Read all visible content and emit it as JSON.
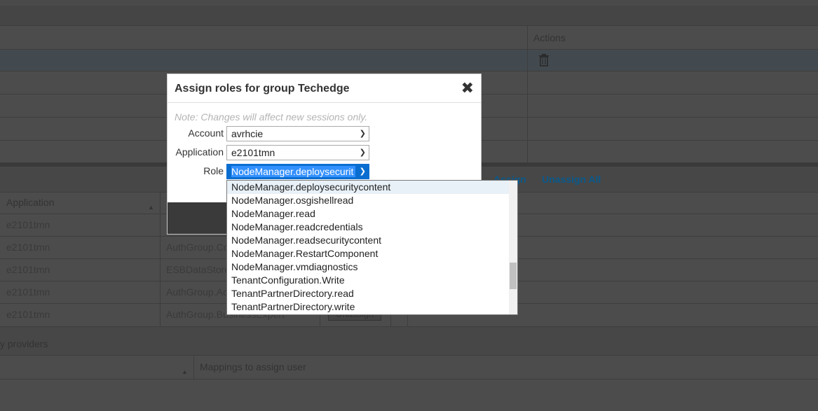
{
  "background": {
    "top_table": {
      "actions_header": "Actions",
      "trash_icon": "trash-icon"
    },
    "middle": {
      "assign_link": "Assign",
      "unassign_all_link": "Unassign All",
      "application_header": "Application",
      "rows": [
        {
          "application": "e2101tmn",
          "group": "",
          "button": ""
        },
        {
          "application": "e2101tmn",
          "group": "AuthGroup.Co",
          "button": ""
        },
        {
          "application": "e2101tmn",
          "group": "ESBDataStore",
          "button": ""
        },
        {
          "application": "e2101tmn",
          "group": "AuthGroup.Ac",
          "button": ""
        },
        {
          "application": "e2101tmn",
          "group": "AuthGroup.BusinessExpert",
          "button": "Unassign"
        }
      ]
    },
    "bottom": {
      "providers_label": "y providers",
      "mappings_header": "Mappings to assign user"
    }
  },
  "modal": {
    "title": "Assign roles for group Techedge",
    "close_icon": "close-icon",
    "note": "Note: Changes will affect new sessions only.",
    "account_label": "Account",
    "account_value": "avrhcie",
    "application_label": "Application",
    "application_value": "e2101tmn",
    "role_label": "Role",
    "role_value": "NodeManager.deploysecurit"
  },
  "role_options": [
    "NodeManager.deploysecuritycontent",
    "NodeManager.osgishellread",
    "NodeManager.read",
    "NodeManager.readcredentials",
    "NodeManager.readsecuritycontent",
    "NodeManager.RestartComponent",
    "NodeManager.vmdiagnostics",
    "TenantConfiguration.Write",
    "TenantPartnerDirectory.read",
    "TenantPartnerDirectory.write"
  ],
  "highlighted_option_index": 0,
  "colors": {
    "overlay": "#4c4c4c",
    "link": "#0a5a8c",
    "select_active": "#0a6ed1",
    "text_selection": "#3390ff"
  }
}
